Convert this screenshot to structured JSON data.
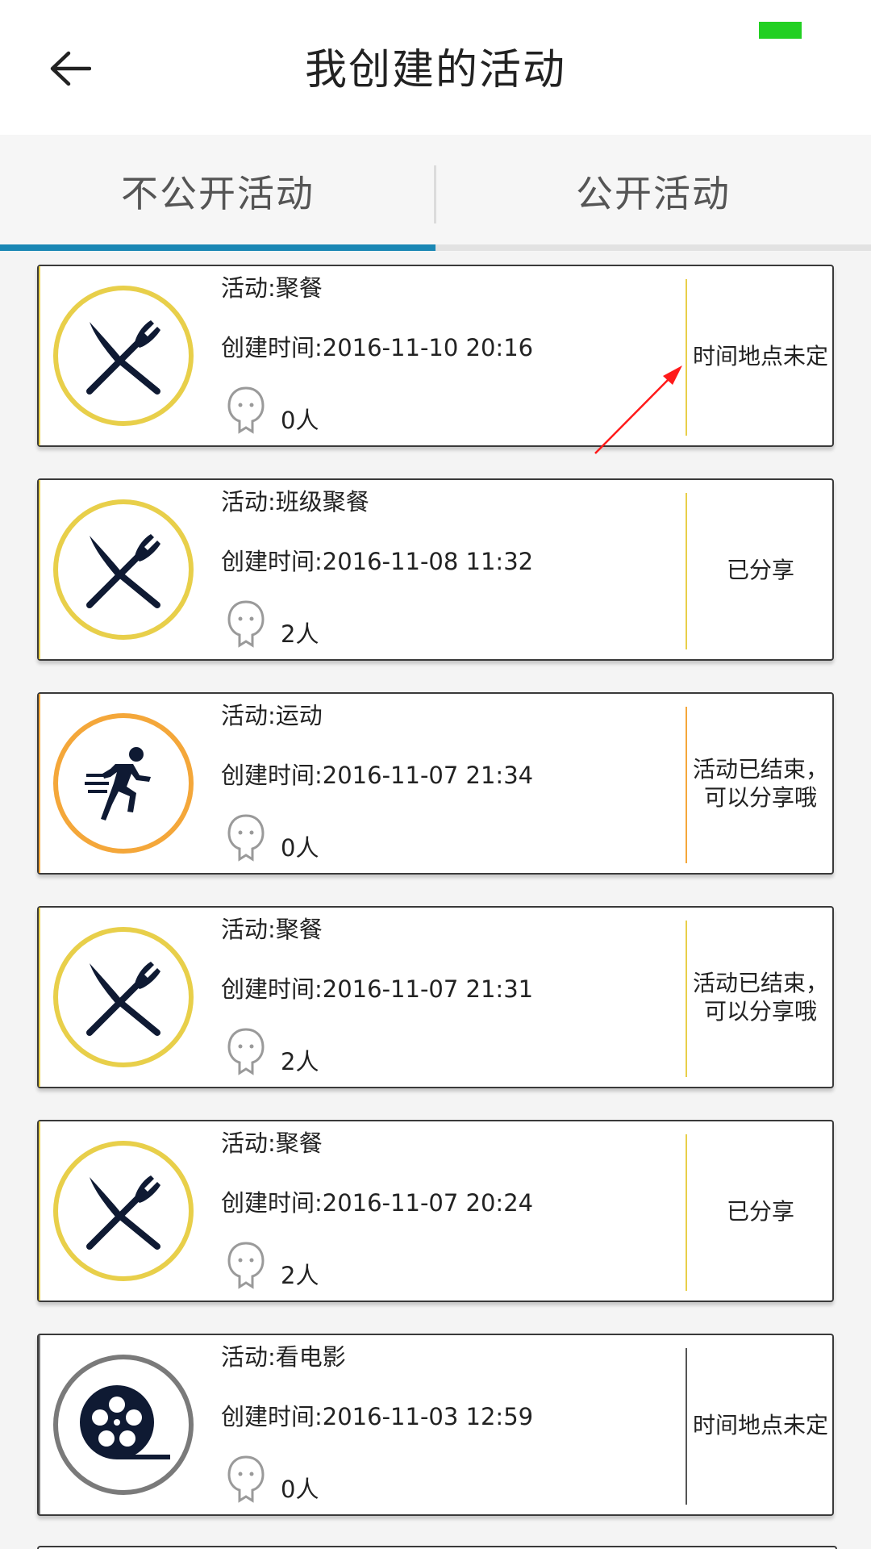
{
  "header": {
    "title": "我创建的活动",
    "back_icon": "back-arrow-icon"
  },
  "tabs": [
    {
      "label": "不公开活动",
      "active": true
    },
    {
      "label": "公开活动",
      "active": false
    }
  ],
  "colors": {
    "accent": "#1a87b4",
    "food_ring": "#e8cf4a",
    "sport_ring": "#f4a73a",
    "movie_ring": "#7a7a7a",
    "annotation_arrow": "#ff1a1a"
  },
  "activities": [
    {
      "name": "活动:聚餐",
      "created": "创建时间:2016-11-10 20:16",
      "count": "0人",
      "status": "时间地点未定",
      "icon": "fork-knife-icon"
    },
    {
      "name": "活动:班级聚餐",
      "created": "创建时间:2016-11-08 11:32",
      "count": "2人",
      "status": "已分享",
      "icon": "fork-knife-icon"
    },
    {
      "name": "活动:运动",
      "created": "创建时间:2016-11-07 21:34",
      "count": "0人",
      "status": "活动已结束，\n可以分享哦",
      "icon": "runner-icon"
    },
    {
      "name": "活动:聚餐",
      "created": "创建时间:2016-11-07 21:31",
      "count": "2人",
      "status": "活动已结束，\n可以分享哦",
      "icon": "fork-knife-icon"
    },
    {
      "name": "活动:聚餐",
      "created": "创建时间:2016-11-07 20:24",
      "count": "2人",
      "status": "已分享",
      "icon": "fork-knife-icon"
    },
    {
      "name": "活动:看电影",
      "created": "创建时间:2016-11-03 12:59",
      "count": "0人",
      "status": "时间地点未定",
      "icon": "film-reel-icon"
    }
  ]
}
